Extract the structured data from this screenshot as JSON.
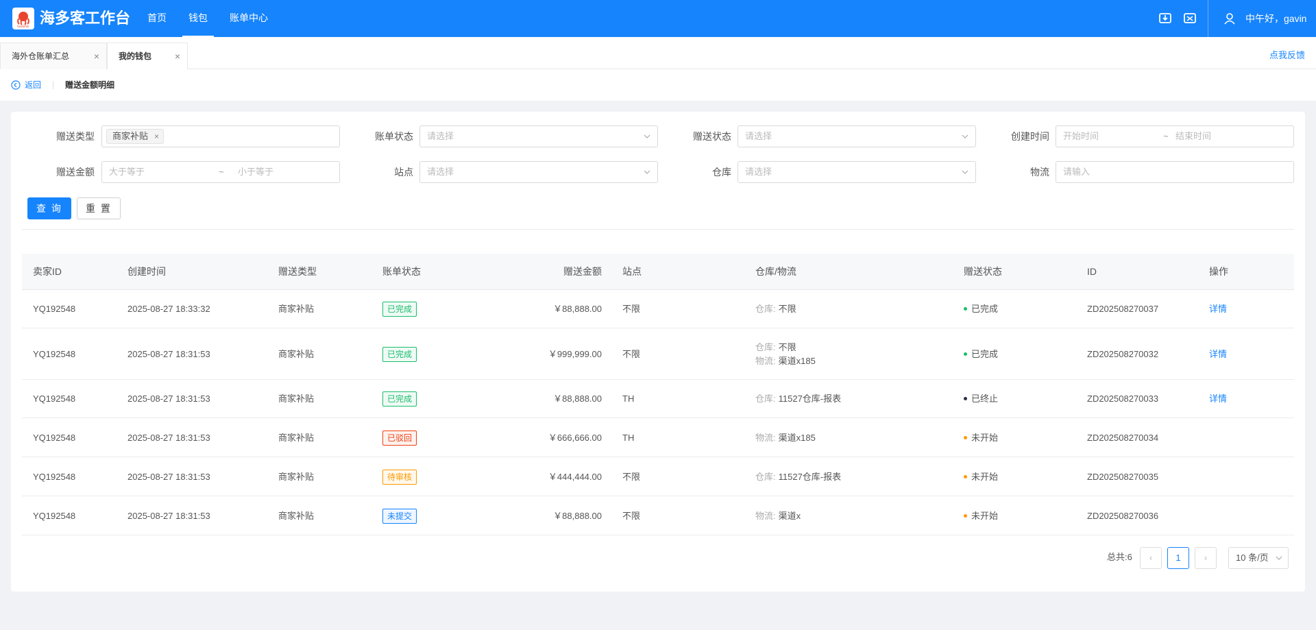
{
  "header": {
    "logo_text": "SeaSmkr",
    "app_title": "海多客工作台",
    "nav": [
      {
        "label": "首页"
      },
      {
        "label": "钱包"
      },
      {
        "label": "账单中心"
      }
    ],
    "greeting": "中午好，gavin"
  },
  "tabs": [
    {
      "label": "海外仓账单汇总",
      "close": "×"
    },
    {
      "label": "我的钱包",
      "close": "×"
    }
  ],
  "feedback_label": "点我反馈",
  "breadcrumb": {
    "back_label": "返回",
    "title": "赠送金额明细"
  },
  "filters": {
    "gift_type": {
      "label": "赠送类型",
      "tag": "商家补贴",
      "tag_close": "×"
    },
    "bill_status": {
      "label": "账单状态",
      "placeholder": "请选择"
    },
    "gift_status": {
      "label": "赠送状态",
      "placeholder": "请选择"
    },
    "created_time": {
      "label": "创建时间",
      "start_placeholder": "开始时间",
      "separator": "~",
      "end_placeholder": "结束时间"
    },
    "gift_amount": {
      "label": "赠送金额",
      "min_placeholder": "大于等于",
      "separator": "~",
      "max_placeholder": "小于等于"
    },
    "site": {
      "label": "站点",
      "placeholder": "请选择"
    },
    "warehouse": {
      "label": "仓库",
      "placeholder": "请选择"
    },
    "logistics": {
      "label": "物流",
      "placeholder": "请输入"
    }
  },
  "buttons": {
    "query": "查 询",
    "reset": "重 置"
  },
  "table": {
    "columns": [
      "卖家ID",
      "创建时间",
      "赠送类型",
      "账单状态",
      "赠送金额",
      "站点",
      "仓库/物流",
      "赠送状态",
      "ID",
      "操作"
    ],
    "rows": [
      {
        "seller_id": "YQ192548",
        "created": "2025-08-27 18:33:32",
        "type": "商家补贴",
        "bill_status": "已完成",
        "bill_color": "#19be6b",
        "amount": "￥88,888.00",
        "site": "不限",
        "wl": [
          {
            "k": "仓库:",
            "v": "不限"
          }
        ],
        "gift_status": "已完成",
        "dot_color": "#19be6b",
        "id": "ZD202508270037",
        "action": "详情"
      },
      {
        "seller_id": "YQ192548",
        "created": "2025-08-27 18:31:53",
        "type": "商家补贴",
        "bill_status": "已完成",
        "bill_color": "#19be6b",
        "amount": "￥999,999.00",
        "site": "不限",
        "wl": [
          {
            "k": "仓库:",
            "v": "不限"
          },
          {
            "k": "物流:",
            "v": "渠道x185"
          }
        ],
        "gift_status": "已完成",
        "dot_color": "#19be6b",
        "id": "ZD202508270032",
        "action": "详情"
      },
      {
        "seller_id": "YQ192548",
        "created": "2025-08-27 18:31:53",
        "type": "商家补贴",
        "bill_status": "已完成",
        "bill_color": "#19be6b",
        "amount": "￥88,888.00",
        "site": "TH",
        "wl": [
          {
            "k": "仓库:",
            "v": "11527仓库-报表"
          }
        ],
        "gift_status": "已终止",
        "dot_color": "#2a2f45",
        "id": "ZD202508270033",
        "action": "详情"
      },
      {
        "seller_id": "YQ192548",
        "created": "2025-08-27 18:31:53",
        "type": "商家补贴",
        "bill_status": "已驳回",
        "bill_color": "#ed4014",
        "amount": "￥666,666.00",
        "site": "TH",
        "wl": [
          {
            "k": "物流:",
            "v": "渠道x185"
          }
        ],
        "gift_status": "未开始",
        "dot_color": "#ff9900",
        "id": "ZD202508270034",
        "action": ""
      },
      {
        "seller_id": "YQ192548",
        "created": "2025-08-27 18:31:53",
        "type": "商家补贴",
        "bill_status": "待审核",
        "bill_color": "#ff9900",
        "amount": "￥444,444.00",
        "site": "不限",
        "wl": [
          {
            "k": "仓库:",
            "v": "11527仓库-报表"
          }
        ],
        "gift_status": "未开始",
        "dot_color": "#ff9900",
        "id": "ZD202508270035",
        "action": ""
      },
      {
        "seller_id": "YQ192548",
        "created": "2025-08-27 18:31:53",
        "type": "商家补贴",
        "bill_status": "未提交",
        "bill_color": "#1684fc",
        "amount": "￥88,888.00",
        "site": "不限",
        "wl": [
          {
            "k": "物流:",
            "v": "渠道x"
          }
        ],
        "gift_status": "未开始",
        "dot_color": "#ff9900",
        "id": "ZD202508270036",
        "action": ""
      }
    ]
  },
  "pagination": {
    "total_label": "总共:6",
    "prev": "‹",
    "current": "1",
    "next": "›",
    "page_size": "10 条/页"
  },
  "colors": {
    "primary": "#1684fc",
    "success": "#19be6b",
    "danger": "#ed4014",
    "warning": "#ff9900"
  }
}
